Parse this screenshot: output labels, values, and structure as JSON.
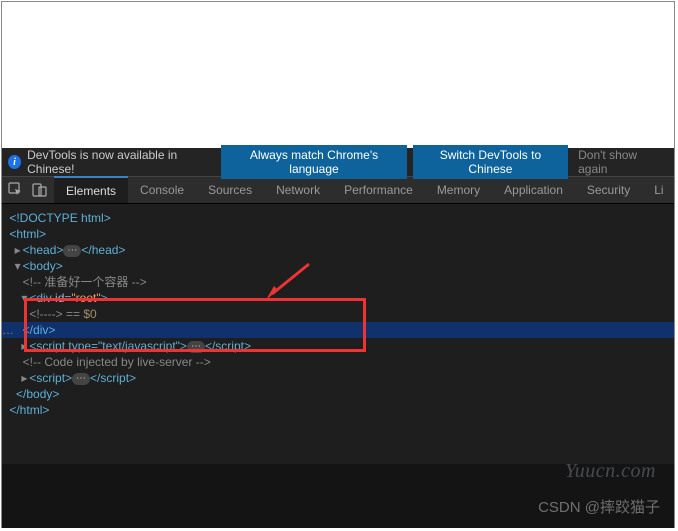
{
  "infobar": {
    "message": "DevTools is now available in Chinese!",
    "btn_always": "Always match Chrome's language",
    "btn_switch": "Switch DevTools to Chinese",
    "btn_dismiss": "Don't show again"
  },
  "tabs": {
    "elements": "Elements",
    "console": "Console",
    "sources": "Sources",
    "network": "Network",
    "performance": "Performance",
    "memory": "Memory",
    "application": "Application",
    "security": "Security",
    "lighthouse": "Li"
  },
  "dom": {
    "doctype": "<!DOCTYPE html>",
    "html_open": "<html>",
    "head_open": "<head>",
    "head_close": "</head>",
    "body_open": "<body>",
    "comment_container": "<!-- 准备好一个容器 -->",
    "div_open_tag": "div",
    "div_open_attr_name": "id",
    "div_open_attr_val": "\"root\"",
    "empty_comment": "<!---->",
    "eq_var": " == ",
    "var0": "$0",
    "div_close": "</div>",
    "script1_open": "<script type=\"text/javascript\">",
    "script1_close": "</script>",
    "comment_live": "<!-- Code injected by live-server -->",
    "script2_open": "<script>",
    "script2_close": "</script>",
    "body_close": "</body>",
    "html_close": "</html>"
  },
  "watermarks": {
    "site": "Yuucn.com",
    "csdn": "CSDN @摔跤猫子"
  }
}
